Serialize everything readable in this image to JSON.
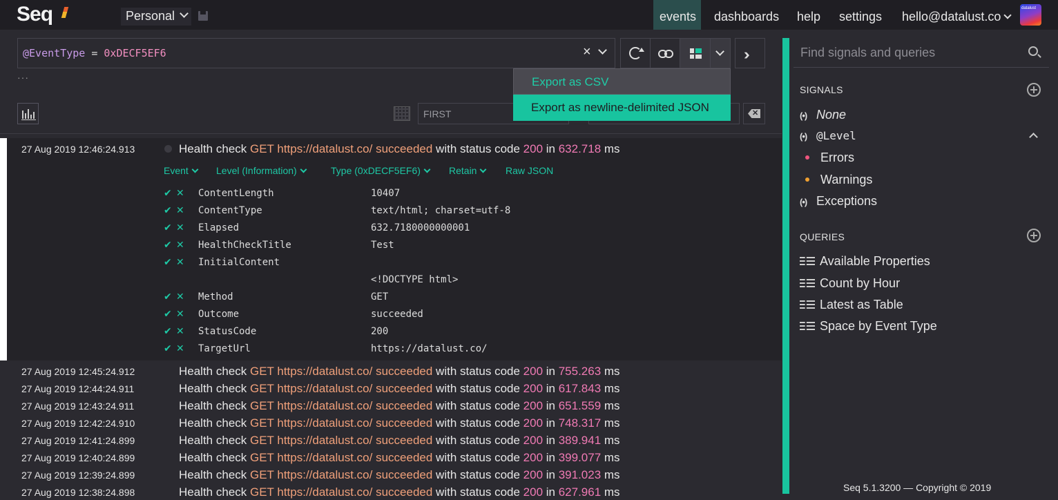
{
  "app": {
    "logo": "Seq"
  },
  "workspace": {
    "label": "Personal"
  },
  "nav": {
    "events": "events",
    "dashboards": "dashboards",
    "help": "help",
    "settings": "settings",
    "user": "hello@datalust.co",
    "avatar_text": "datalust"
  },
  "query": {
    "property": "@EventType",
    "operator": "=",
    "value": "0xDECF5EF6",
    "clear": "×"
  },
  "toolbar": {
    "ellipsis": "···",
    "first_placeholder": "FIRST",
    "last_placeholder": ""
  },
  "export_menu": {
    "csv": "Export as CSV",
    "json": "Export as newline-delimited JSON"
  },
  "selected_event": {
    "timestamp": "27 Aug 2019  12:46:24.913",
    "tabs": [
      "Event",
      "Level (Information)",
      "Type (0xDECF5EF6)",
      "Retain",
      "Raw JSON"
    ],
    "properties": [
      {
        "name": "ContentLength",
        "value": "10407",
        "actions": true
      },
      {
        "name": "ContentType",
        "value": "text/html; charset=utf-8",
        "actions": true
      },
      {
        "name": "Elapsed",
        "value": "632.7180000000001",
        "actions": true
      },
      {
        "name": "HealthCheckTitle",
        "value": "Test",
        "actions": true
      },
      {
        "name": "InitialContent",
        "value": "",
        "actions": true
      },
      {
        "name": "",
        "value": "<!DOCTYPE html>",
        "actions": false
      },
      {
        "name": "Method",
        "value": "GET",
        "actions": true
      },
      {
        "name": "Outcome",
        "value": "succeeded",
        "actions": true
      },
      {
        "name": "StatusCode",
        "value": "200",
        "actions": true
      },
      {
        "name": "TargetUrl",
        "value": "https://datalust.co/",
        "actions": true
      }
    ]
  },
  "message_parts": {
    "prefix": "Health check ",
    "method": "GET",
    "url": "https://datalust.co/",
    "outcome": "succeeded",
    "mid": " with status code ",
    "status": "200",
    "in": " in ",
    "unit": " ms"
  },
  "events": [
    {
      "timestamp": "27 Aug 2019  12:46:24.913",
      "elapsed": "632.718"
    },
    {
      "timestamp": "27 Aug 2019  12:45:24.912",
      "elapsed": "755.263"
    },
    {
      "timestamp": "27 Aug 2019  12:44:24.911",
      "elapsed": "617.843"
    },
    {
      "timestamp": "27 Aug 2019  12:43:24.911",
      "elapsed": "651.559"
    },
    {
      "timestamp": "27 Aug 2019  12:42:24.910",
      "elapsed": "748.317"
    },
    {
      "timestamp": "27 Aug 2019  12:41:24.899",
      "elapsed": "389.941"
    },
    {
      "timestamp": "27 Aug 2019  12:40:24.899",
      "elapsed": "399.077"
    },
    {
      "timestamp": "27 Aug 2019  12:39:24.899",
      "elapsed": "391.023"
    },
    {
      "timestamp": "27 Aug 2019  12:38:24.898",
      "elapsed": "627.961"
    }
  ],
  "sidebar": {
    "search_placeholder": "Find signals and queries",
    "signals_heading": "SIGNALS",
    "signals": {
      "none": "None",
      "level": "@Level",
      "level_children": [
        {
          "label": "Errors",
          "color": "#f0557e"
        },
        {
          "label": "Warnings",
          "color": "#f0a030"
        }
      ],
      "exceptions": "Exceptions"
    },
    "queries_heading": "QUERIES",
    "queries": [
      "Available Properties",
      "Count by Hour",
      "Latest as Table",
      "Space by Event Type"
    ]
  },
  "footer": "Seq 5.1.3200 — Copyright © 2019",
  "colors": {
    "accent": "#19c49e",
    "string": "#f0a07a",
    "number": "#f07ab4"
  }
}
